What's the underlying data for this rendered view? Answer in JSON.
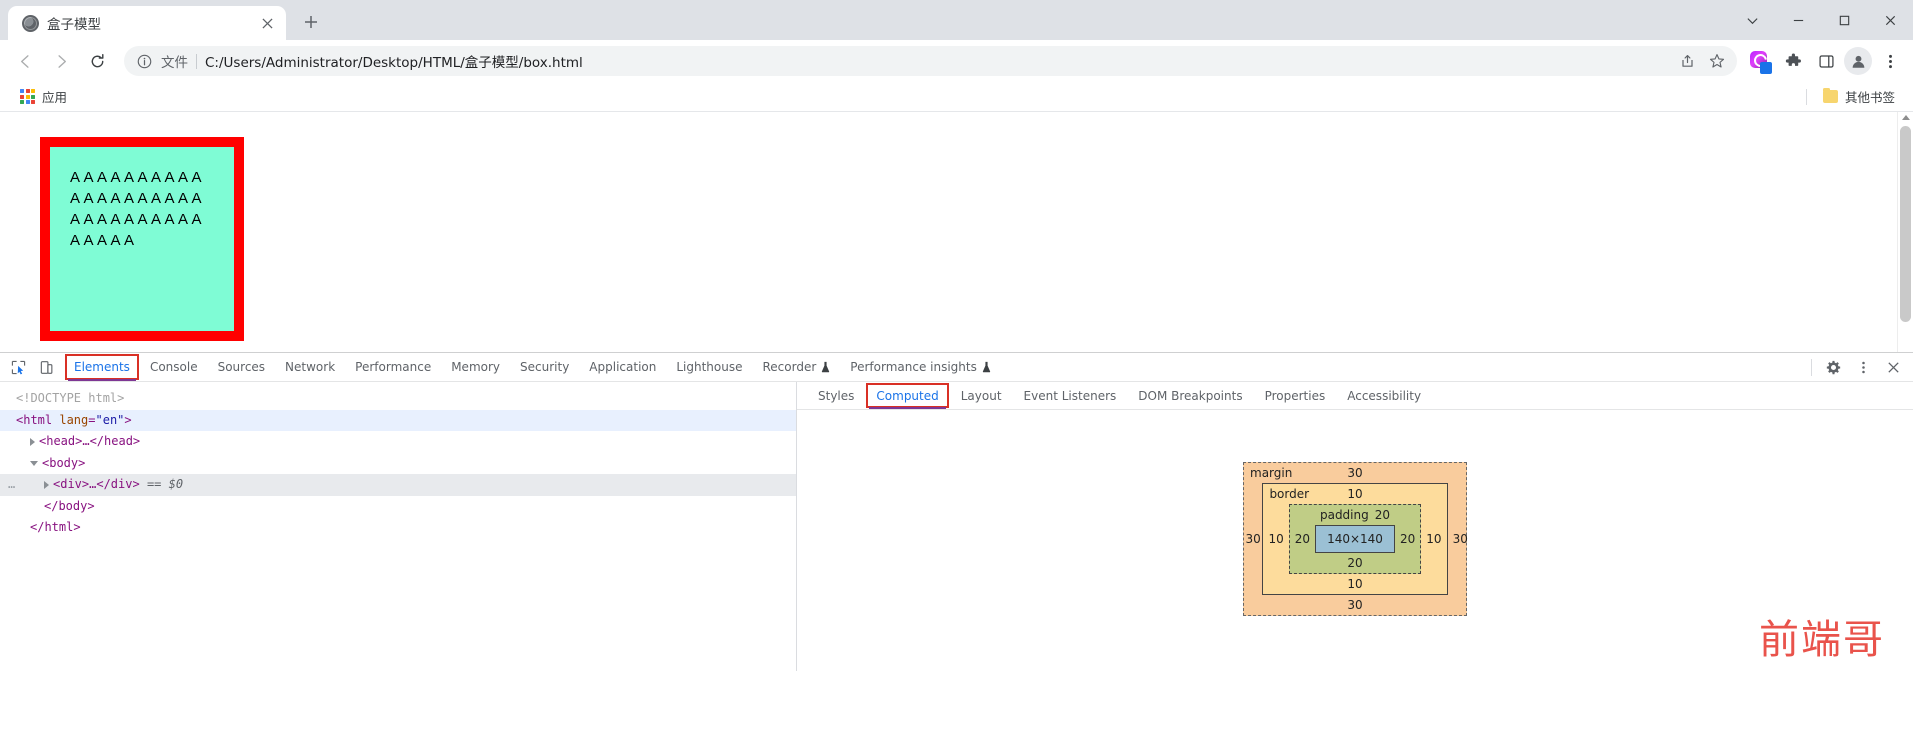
{
  "browser": {
    "tab": {
      "title": "盒子模型",
      "favicon": "globe-icon",
      "close": "✕"
    },
    "new_tab_label": "+",
    "window_controls": {
      "tab_search": "chevron-down-icon",
      "minimize": "minimize-icon",
      "maximize": "maximize-icon",
      "close": "close-icon"
    },
    "nav": {
      "back": "back-arrow-icon",
      "forward": "forward-arrow-icon",
      "reload": "reload-icon"
    },
    "omnibox": {
      "info_icon": "info-circle-icon",
      "scheme_label": "文件",
      "url": "C:/Users/Administrator/Desktop/HTML/盒子模型/box.html",
      "share_icon": "share-icon",
      "bookmark_icon": "star-icon"
    },
    "toolbar_right": {
      "extension_colorful": "extension-icon",
      "extensions_puzzle": "puzzle-piece-icon",
      "side_panel": "side-panel-icon",
      "profile": "profile-avatar-icon",
      "menu": "three-dot-menu-icon"
    },
    "bookmarks_bar": {
      "apps_label": "应用",
      "apps_icon": "apps-grid-icon",
      "other_bookmarks_label": "其他书签",
      "other_bookmarks_icon": "folder-icon"
    }
  },
  "page": {
    "box_text": "AAAAAAAAAAAAAAAAAAAAAAAAAAAAAAAAAAA",
    "colors": {
      "border": "#ff0000",
      "background": "#7ffcd5"
    }
  },
  "devtools": {
    "toolbar": {
      "inspect_icon": "inspect-cursor-icon",
      "device_toggle_icon": "device-toolbar-icon",
      "settings_icon": "gear-icon",
      "more_icon": "three-dot-menu-icon",
      "close_icon": "close-icon",
      "tabs": [
        {
          "label": "Elements",
          "active": true,
          "highlighted": true,
          "preview": false
        },
        {
          "label": "Console",
          "active": false,
          "highlighted": false,
          "preview": false
        },
        {
          "label": "Sources",
          "active": false,
          "highlighted": false,
          "preview": false
        },
        {
          "label": "Network",
          "active": false,
          "highlighted": false,
          "preview": false
        },
        {
          "label": "Performance",
          "active": false,
          "highlighted": false,
          "preview": false
        },
        {
          "label": "Memory",
          "active": false,
          "highlighted": false,
          "preview": false
        },
        {
          "label": "Security",
          "active": false,
          "highlighted": false,
          "preview": false
        },
        {
          "label": "Application",
          "active": false,
          "highlighted": false,
          "preview": false
        },
        {
          "label": "Lighthouse",
          "active": false,
          "highlighted": false,
          "preview": false
        },
        {
          "label": "Recorder",
          "active": false,
          "highlighted": false,
          "preview": true
        },
        {
          "label": "Performance insights",
          "active": false,
          "highlighted": false,
          "preview": true
        }
      ]
    },
    "dom_tree": {
      "doctype": "<!DOCTYPE html>",
      "html_open_tag": "<html",
      "html_attr_name": "lang",
      "html_attr_value": "\"en\"",
      "html_open_close": ">",
      "head_line": "<head>…</head>",
      "body_open": "<body>",
      "div_line": "<div>…</div>",
      "div_ref": "== $0",
      "gutter_dots": "…",
      "body_close": "</body>",
      "html_close": "</html>"
    },
    "sidebar_tabs": [
      {
        "label": "Styles",
        "active": false,
        "highlighted": false
      },
      {
        "label": "Computed",
        "active": true,
        "highlighted": true
      },
      {
        "label": "Layout",
        "active": false,
        "highlighted": false
      },
      {
        "label": "Event Listeners",
        "active": false,
        "highlighted": false
      },
      {
        "label": "DOM Breakpoints",
        "active": false,
        "highlighted": false
      },
      {
        "label": "Properties",
        "active": false,
        "highlighted": false
      },
      {
        "label": "Accessibility",
        "active": false,
        "highlighted": false
      }
    ],
    "box_model": {
      "margin_label": "margin",
      "border_label": "border",
      "padding_label": "padding",
      "margin": {
        "top": "30",
        "right": "30",
        "bottom": "30",
        "left": "30"
      },
      "border": {
        "top": "10",
        "right": "10",
        "bottom": "10",
        "left": "10"
      },
      "padding": {
        "top": "20",
        "right": "20",
        "bottom": "20",
        "left": "20"
      },
      "content": "140×140",
      "colors": {
        "margin_fill": "#f9cc9d",
        "border_fill": "#fddc9c",
        "padding_fill": "#c0cd86",
        "content_fill": "#9bc0d4"
      }
    }
  },
  "watermark": {
    "text": "前端哥",
    "color": "#e8453c"
  }
}
